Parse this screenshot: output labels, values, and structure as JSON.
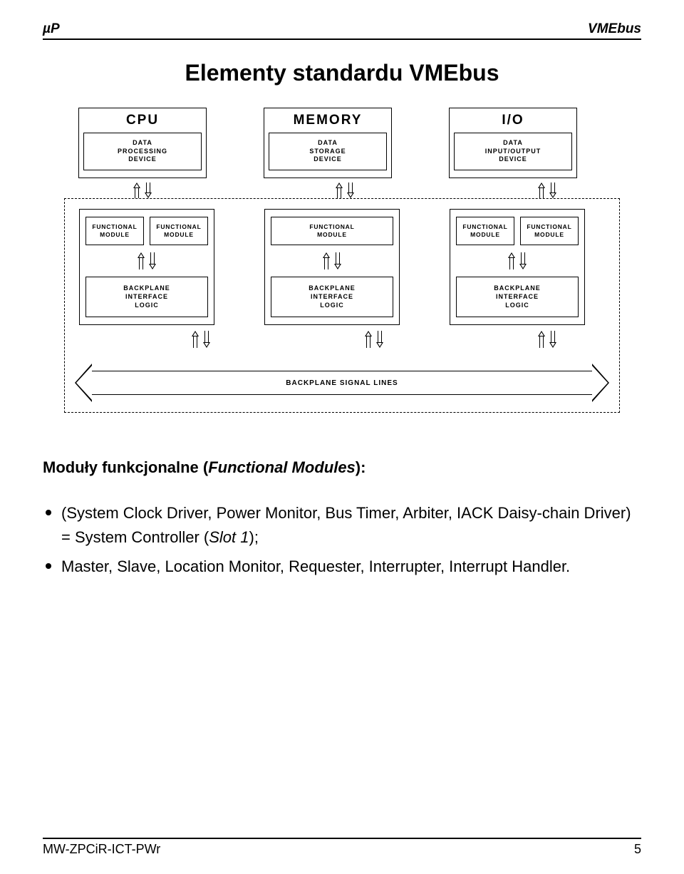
{
  "header": {
    "left": "µP",
    "right": "VMEbus"
  },
  "title": "Elementy standardu VMEbus",
  "diagram": {
    "devices": [
      {
        "title": "CPU",
        "box": "DATA\nPROCESSING\nDEVICE"
      },
      {
        "title": "MEMORY",
        "box": "DATA\nSTORAGE\nDEVICE"
      },
      {
        "title": "I/O",
        "box": "DATA\nINPUT/OUTPUT\nDEVICE"
      }
    ],
    "fm_label": "FUNCTIONAL\nMODULE",
    "bil_label": "BACKPLANE\nINTERFACE\nLOGIC",
    "bus_label": "BACKPLANE SIGNAL LINES",
    "cards": [
      {
        "fm_count": 2
      },
      {
        "fm_count": 1
      },
      {
        "fm_count": 2
      }
    ]
  },
  "subtitle_prefix": "Moduły funkcjonalne (",
  "subtitle_em": "Functional Modules",
  "subtitle_suffix": "):",
  "bullets": [
    {
      "pre": "(System Clock Driver, Power Monitor, Bus Timer, Arbiter, IACK Daisy-chain Driver) = System Controller (",
      "em": "Slot 1",
      "post": ");"
    },
    {
      "pre": "Master, Slave, Location Monitor, Requester, Interrupter, Interrupt Handler.",
      "em": "",
      "post": ""
    }
  ],
  "footer": {
    "left": "MW-ZPCiR-ICT-PWr",
    "right": "5"
  }
}
